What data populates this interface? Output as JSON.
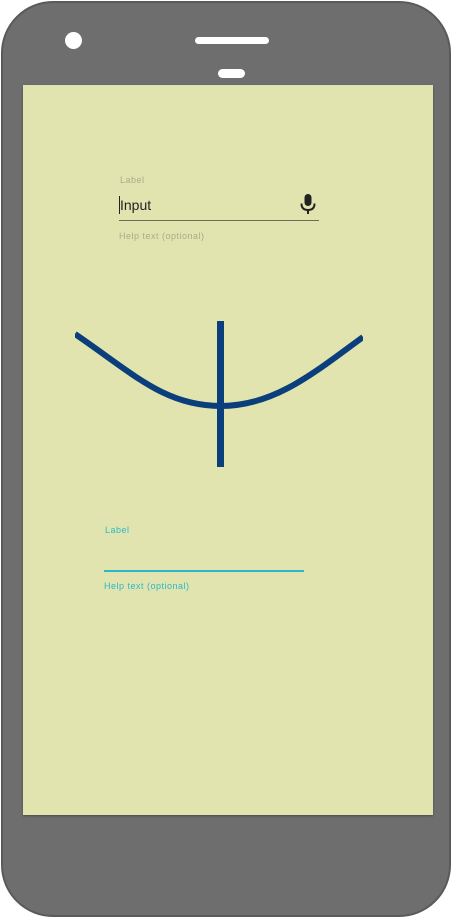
{
  "colors": {
    "phone_frame": "#6e6e6e",
    "screen_background": "#e2e4b0",
    "muted_text": "#a9ab8a",
    "accent": "#2bb8c8",
    "graphic_stroke": "#0a3f7c"
  },
  "field_top": {
    "label": "Label",
    "value": "Input",
    "help": "Help text (optional)",
    "trailing_icon": "mic-icon"
  },
  "field_bottom": {
    "label": "Label",
    "value": "",
    "help": "Help text (optional)"
  },
  "graphic": {
    "icon": "curve-with-vertical-line"
  }
}
